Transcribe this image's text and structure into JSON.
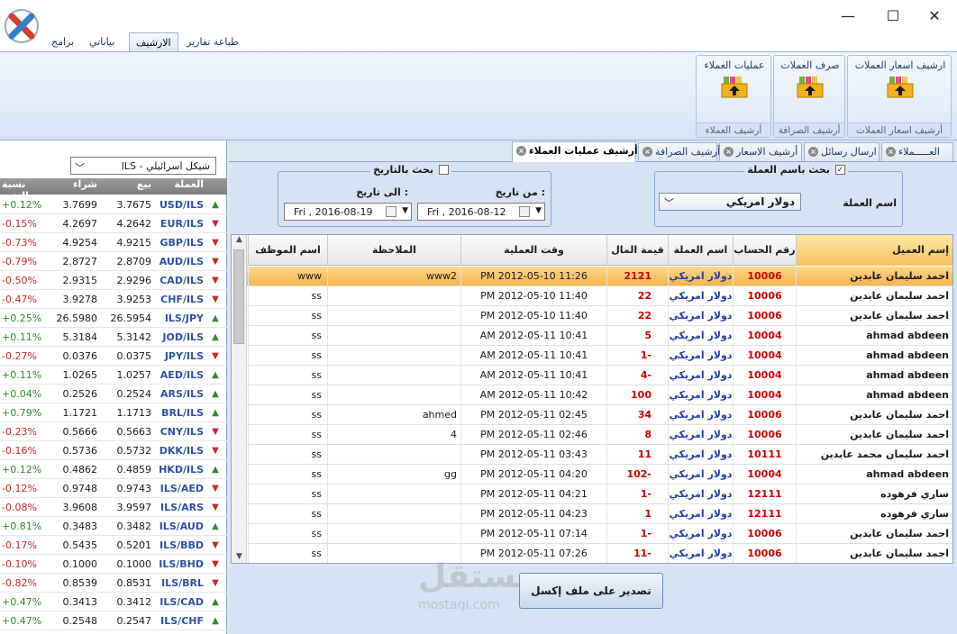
{
  "window": {
    "minimize": "—",
    "maximize": "☐",
    "close": "✕"
  },
  "ribbon": {
    "tabs": [
      "طباعة تقارير",
      "الارشيف",
      "بياناتي",
      "برامج"
    ],
    "groups": [
      {
        "button": "ارشيف اسعار العملات",
        "label": "أرشيف اسعار العملات"
      },
      {
        "button": "صرف العملات",
        "label": "أرشيف الصرافة"
      },
      {
        "button": "عمليات العملاء",
        "label": "أرشيف العملاء"
      }
    ]
  },
  "ticker": {
    "selected": "ILS - شيكل اسرائيلي",
    "headers": {
      "currency": "العملة",
      "sell": "بيع",
      "buy": "شراء",
      "change": "نسبة التغير"
    },
    "rows": [
      {
        "cur": "USD/ILS",
        "sell": "3.7675",
        "buy": "3.7699",
        "chg": "+0.12%",
        "dir": "up"
      },
      {
        "cur": "EUR/ILS",
        "sell": "4.2642",
        "buy": "4.2697",
        "chg": "-0.15%",
        "dir": "dn"
      },
      {
        "cur": "GBP/ILS",
        "sell": "4.9215",
        "buy": "4.9254",
        "chg": "-0.73%",
        "dir": "dn"
      },
      {
        "cur": "AUD/ILS",
        "sell": "2.8709",
        "buy": "2.8727",
        "chg": "-0.79%",
        "dir": "dn"
      },
      {
        "cur": "CAD/ILS",
        "sell": "2.9296",
        "buy": "2.9315",
        "chg": "-0.50%",
        "dir": "dn"
      },
      {
        "cur": "CHF/ILS",
        "sell": "3.9253",
        "buy": "3.9278",
        "chg": "-0.47%",
        "dir": "dn"
      },
      {
        "cur": "ILS/JPY",
        "sell": "26.5954",
        "buy": "26.5980",
        "chg": "+0.25%",
        "dir": "up"
      },
      {
        "cur": "JOD/ILS",
        "sell": "5.3142",
        "buy": "5.3184",
        "chg": "+0.11%",
        "dir": "up"
      },
      {
        "cur": "JPY/ILS",
        "sell": "0.0375",
        "buy": "0.0376",
        "chg": "-0.27%",
        "dir": "dn"
      },
      {
        "cur": "AED/ILS",
        "sell": "1.0257",
        "buy": "1.0265",
        "chg": "+0.11%",
        "dir": "up"
      },
      {
        "cur": "ARS/ILS",
        "sell": "0.2524",
        "buy": "0.2526",
        "chg": "+0.04%",
        "dir": "up"
      },
      {
        "cur": "BRL/ILS",
        "sell": "1.1713",
        "buy": "1.1721",
        "chg": "+0.79%",
        "dir": "up"
      },
      {
        "cur": "CNY/ILS",
        "sell": "0.5663",
        "buy": "0.5666",
        "chg": "-0.23%",
        "dir": "dn"
      },
      {
        "cur": "DKK/ILS",
        "sell": "0.5732",
        "buy": "0.5736",
        "chg": "-0.16%",
        "dir": "dn"
      },
      {
        "cur": "HKD/ILS",
        "sell": "0.4859",
        "buy": "0.4862",
        "chg": "+0.12%",
        "dir": "up"
      },
      {
        "cur": "ILS/AED",
        "sell": "0.9743",
        "buy": "0.9748",
        "chg": "-0.12%",
        "dir": "dn"
      },
      {
        "cur": "ILS/ARS",
        "sell": "3.9597",
        "buy": "3.9608",
        "chg": "-0.08%",
        "dir": "dn"
      },
      {
        "cur": "ILS/AUD",
        "sell": "0.3482",
        "buy": "0.3483",
        "chg": "+0.81%",
        "dir": "up"
      },
      {
        "cur": "ILS/BBD",
        "sell": "0.5201",
        "buy": "0.5435",
        "chg": "-0.17%",
        "dir": "dn"
      },
      {
        "cur": "ILS/BHD",
        "sell": "0.1000",
        "buy": "0.1000",
        "chg": "-0.10%",
        "dir": "dn"
      },
      {
        "cur": "ILS/BRL",
        "sell": "0.8531",
        "buy": "0.8539",
        "chg": "-0.82%",
        "dir": "dn"
      },
      {
        "cur": "ILS/CAD",
        "sell": "0.3412",
        "buy": "0.3413",
        "chg": "+0.47%",
        "dir": "up"
      },
      {
        "cur": "ILS/CHF",
        "sell": "0.2547",
        "buy": "0.2548",
        "chg": "+0.47%",
        "dir": "up"
      }
    ]
  },
  "doc_tabs": [
    "العـــــملاء",
    "ارسال رسائل",
    "أرشيف الاسعار",
    "أرشيف الصرافة",
    "أرشيف عمليات العملاء"
  ],
  "filters": {
    "currency_group": {
      "legend": "بحث باسم العملة",
      "checked": "✓",
      "label": "اسم العملة",
      "value": "دولار امريكي"
    },
    "date_group": {
      "legend": "بحث بالتاريخ",
      "from_label": "من تاريخ :",
      "to_label": "الى تاريخ :",
      "from_value": "Fri  ,  2016-08-12",
      "to_value": "Fri  ,  2016-08-19"
    }
  },
  "grid": {
    "headers": {
      "client": "إسم العميل",
      "account": "رقم الحساب",
      "currency": "اسم العملة",
      "amount": "قيمة المال",
      "time": "وقت العملية",
      "note": "الملاحظة",
      "employee": "اسم الموظف"
    },
    "rows": [
      {
        "client": "احمد سليمان عابدين",
        "account": "10006",
        "currency": "دولار امريكي",
        "amount": "2121",
        "time": "PM 2012-05-10     11:26",
        "note": "www2",
        "employee": "www",
        "selected": true
      },
      {
        "client": "احمد سليمان عابدين",
        "account": "10006",
        "currency": "دولار امريكي",
        "amount": "22",
        "time": "PM 2012-05-10     11:40",
        "note": "",
        "employee": "ss"
      },
      {
        "client": "احمد سليمان عابدين",
        "account": "10006",
        "currency": "دولار امريكي",
        "amount": "22",
        "time": "PM 2012-05-10     11:40",
        "note": "",
        "employee": "ss"
      },
      {
        "client": "ahmad abdeen",
        "account": "10004",
        "currency": "دولار امريكي",
        "amount": "5",
        "time": "AM 2012-05-11     10:41",
        "note": "",
        "employee": "ss"
      },
      {
        "client": "ahmad abdeen",
        "account": "10004",
        "currency": "دولار امريكي",
        "amount": "1-",
        "time": "AM 2012-05-11     10:41",
        "note": "",
        "employee": "ss"
      },
      {
        "client": "ahmad abdeen",
        "account": "10004",
        "currency": "دولار امريكي",
        "amount": "4-",
        "time": "AM 2012-05-11     10:41",
        "note": "",
        "employee": "ss"
      },
      {
        "client": "ahmad abdeen",
        "account": "10004",
        "currency": "دولار امريكي",
        "amount": "100",
        "time": "AM 2012-05-11     10:42",
        "note": "",
        "employee": "ss"
      },
      {
        "client": "احمد سليمان عابدين",
        "account": "10006",
        "currency": "دولار امريكي",
        "amount": "34",
        "time": "PM 2012-05-11     02:45",
        "note": "ahmed",
        "employee": "ss"
      },
      {
        "client": "احمد سليمان عابدين",
        "account": "10006",
        "currency": "دولار امريكي",
        "amount": "8",
        "time": "PM 2012-05-11     02:46",
        "note": "4",
        "employee": "ss"
      },
      {
        "client": "احمد سليمان محمد عابدين",
        "account": "10111",
        "currency": "دولار امريكي",
        "amount": "11",
        "time": "PM 2012-05-11     03:43",
        "note": "",
        "employee": "ss"
      },
      {
        "client": "ahmad abdeen",
        "account": "10004",
        "currency": "دولار امريكي",
        "amount": "102-",
        "time": "PM 2012-05-11     04:20",
        "note": "gg",
        "employee": "ss"
      },
      {
        "client": "ساري فرهوده",
        "account": "12111",
        "currency": "دولار امريكي",
        "amount": "1-",
        "time": "PM 2012-05-11     04:21",
        "note": "",
        "employee": "ss"
      },
      {
        "client": "ساري فرهوده",
        "account": "12111",
        "currency": "دولار امريكي",
        "amount": "1",
        "time": "PM 2012-05-11     04:23",
        "note": "",
        "employee": "ss"
      },
      {
        "client": "احمد سليمان عابدين",
        "account": "10006",
        "currency": "دولار امريكي",
        "amount": "1-",
        "time": "PM 2012-05-11     07:14",
        "note": "",
        "employee": "ss"
      },
      {
        "client": "احمد سليمان عابدين",
        "account": "10006",
        "currency": "دولار امريكي",
        "amount": "11-",
        "time": "PM 2012-05-11     07:26",
        "note": "",
        "employee": "ss"
      }
    ]
  },
  "export_button": "تصدير على ملف إكسل",
  "watermark": {
    "text": "مستقل",
    "url": "mostaql.com"
  }
}
